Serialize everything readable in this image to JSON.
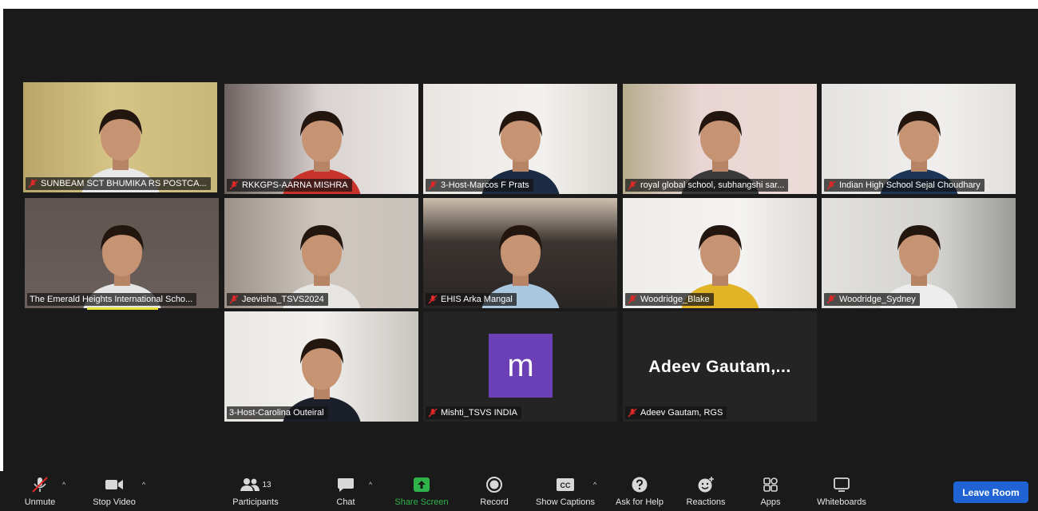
{
  "participants": [
    {
      "name": "SUNBEAM SCT BHUMIKA RS POSTCA..."
    },
    {
      "name": "RKKGPS-AARNA MISHRA"
    },
    {
      "name": "3-Host-Marcos F Prats"
    },
    {
      "name": "royal global school, subhangshi sar..."
    },
    {
      "name": "Indian High School Sejal Choudhary"
    },
    {
      "name": "The Emerald Heights International Scho..."
    },
    {
      "name": "Jeevisha_TSVS2024"
    },
    {
      "name": "EHIS Arka Mangal"
    },
    {
      "name": "Woodridge_Blake"
    },
    {
      "name": "Woodridge_Sydney"
    },
    {
      "name": "3-Host-Carolina Outeiral"
    },
    {
      "name": "Mishti_TSVS INDIA",
      "avatar_letter": "m"
    },
    {
      "name": "Adeev Gautam, RGS",
      "display_text": "Adeev  Gautam,..."
    }
  ],
  "toolbar": {
    "unmute": "Unmute",
    "stop_video": "Stop Video",
    "participants": "Participants",
    "participants_count": "13",
    "chat": "Chat",
    "share_screen": "Share Screen",
    "record": "Record",
    "show_captions": "Show Captions",
    "captions_badge": "CC",
    "ask_for_help": "Ask for Help",
    "reactions": "Reactions",
    "apps": "Apps",
    "whiteboards": "Whiteboards",
    "leave_room": "Leave Room"
  },
  "colors": {
    "active_speaker_border": "#d7e255",
    "share_screen_green": "#2fb24a",
    "leave_button": "#1f63d4",
    "mic_muted_red": "#e02828",
    "avatar_purple": "#6b3fb5"
  }
}
